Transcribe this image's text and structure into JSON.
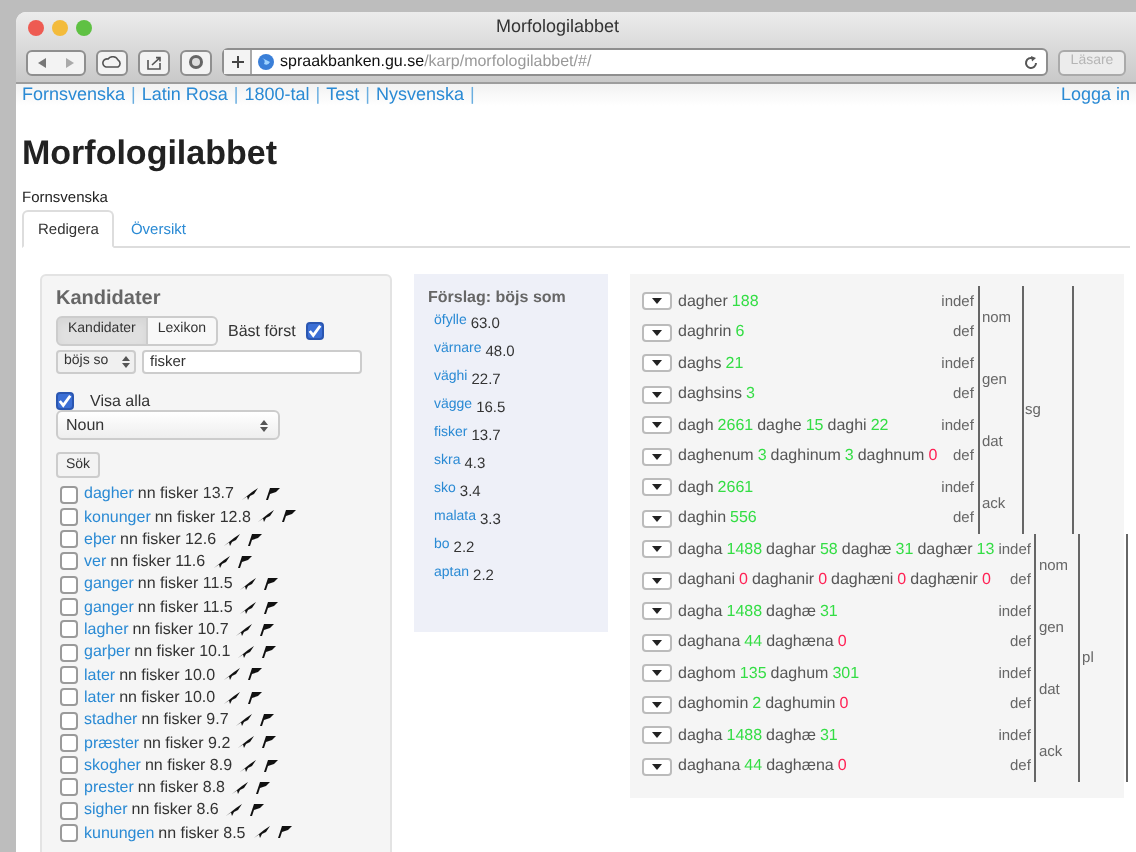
{
  "window": {
    "title": "Morfologilabbet"
  },
  "toolbar": {
    "url_host": "spraakbanken.gu.se",
    "url_path": "/karp/morfologilabbet/#/",
    "reader_button": "Läsare",
    "reader_disabled": true
  },
  "nav": [
    {
      "kind": "link",
      "text": "Fornsvenska"
    },
    {
      "kind": "separator",
      "text": "|"
    },
    {
      "kind": "link",
      "text": "Latin Rosa"
    },
    {
      "kind": "separator",
      "text": "|"
    },
    {
      "kind": "link",
      "text": "1800-tal"
    },
    {
      "kind": "separator",
      "text": "|"
    },
    {
      "kind": "link",
      "text": "Test"
    },
    {
      "kind": "separator",
      "text": "|"
    },
    {
      "kind": "link",
      "text": "Nysvenska"
    },
    {
      "kind": "separator",
      "text": "|"
    }
  ],
  "login": "Logga in",
  "heading": "Morfologilabbet",
  "subheading": "Fornsvenska",
  "tabs": [
    {
      "label": "Redigera",
      "selected": true
    },
    {
      "label": "Översikt",
      "selected": false
    }
  ],
  "candidates_panel": {
    "title": "Kandidater",
    "toggle": [
      {
        "label": "Kandidater",
        "selected": true
      },
      {
        "label": "Lexikon",
        "selected": false
      }
    ],
    "best_first": {
      "label": "Bäst först",
      "checked": true
    },
    "mode_select": "böjs so",
    "query": "fisker",
    "show_all": {
      "label": "Visa alla",
      "checked": true
    },
    "pos_select": "Noun",
    "search_button": "Sök",
    "items": [
      {
        "word": "dagher",
        "rest": "nn fisker 13.7",
        "checked": false
      },
      {
        "word": "konunger",
        "rest": "nn fisker 12.8",
        "checked": false
      },
      {
        "word": "eþer",
        "rest": "nn fisker 12.6",
        "checked": false
      },
      {
        "word": "ver",
        "rest": "nn fisker 11.6",
        "checked": false
      },
      {
        "word": "ganger",
        "rest": "nn fisker 11.5",
        "checked": false
      },
      {
        "word": "ganger",
        "rest": "nn fisker 11.5",
        "checked": false
      },
      {
        "word": "lagher",
        "rest": "nn fisker 10.7",
        "checked": false
      },
      {
        "word": "garþer",
        "rest": "nn fisker 10.1",
        "checked": false
      },
      {
        "word": "later",
        "rest": "nn fisker 10.0",
        "checked": false
      },
      {
        "word": "later",
        "rest": "nn fisker 10.0",
        "checked": false
      },
      {
        "word": "stadher",
        "rest": "nn fisker 9.7",
        "checked": false
      },
      {
        "word": "præster",
        "rest": "nn fisker 9.2",
        "checked": false
      },
      {
        "word": "skogher",
        "rest": "nn fisker 8.9",
        "checked": false
      },
      {
        "word": "prester",
        "rest": "nn fisker 8.8",
        "checked": false
      },
      {
        "word": "sigher",
        "rest": "nn fisker 8.6",
        "checked": false
      },
      {
        "word": "kunungen",
        "rest": "nn fisker 8.5",
        "checked": false
      }
    ]
  },
  "suggestions": {
    "title": "Förslag: böjs som",
    "items": [
      {
        "word": "öfylle",
        "score": "63.0"
      },
      {
        "word": "värnare",
        "score": "48.0"
      },
      {
        "word": "väghi",
        "score": "22.7"
      },
      {
        "word": "vägge",
        "score": "16.5"
      },
      {
        "word": "fisker",
        "score": "13.7"
      },
      {
        "word": "skra",
        "score": "4.3"
      },
      {
        "word": "sko",
        "score": "3.4"
      },
      {
        "word": "malata",
        "score": "3.3"
      },
      {
        "word": "bo",
        "score": "2.2"
      },
      {
        "word": "aptan",
        "score": "2.2"
      }
    ]
  },
  "paradigm": [
    {
      "number": "sg",
      "cases": [
        {
          "case": "nom",
          "rows": [
            {
              "definiteness": "indef",
              "forms": [
                {
                  "word": "dagher",
                  "count": "188",
                  "attested": true
                }
              ]
            },
            {
              "definiteness": "def",
              "forms": [
                {
                  "word": "daghrin",
                  "count": "6",
                  "attested": true
                }
              ]
            }
          ]
        },
        {
          "case": "gen",
          "rows": [
            {
              "definiteness": "indef",
              "forms": [
                {
                  "word": "daghs",
                  "count": "21",
                  "attested": true
                }
              ]
            },
            {
              "definiteness": "def",
              "forms": [
                {
                  "word": "daghsins",
                  "count": "3",
                  "attested": true
                }
              ]
            }
          ]
        },
        {
          "case": "dat",
          "rows": [
            {
              "definiteness": "indef",
              "forms": [
                {
                  "word": "dagh",
                  "count": "2661",
                  "attested": true
                },
                {
                  "word": "daghe",
                  "count": "15",
                  "attested": true
                },
                {
                  "word": "daghi",
                  "count": "22",
                  "attested": true
                }
              ]
            },
            {
              "definiteness": "def",
              "forms": [
                {
                  "word": "daghenum",
                  "count": "3",
                  "attested": true
                },
                {
                  "word": "daghinum",
                  "count": "3",
                  "attested": true
                },
                {
                  "word": "daghnum",
                  "count": "0",
                  "attested": false
                }
              ]
            }
          ]
        },
        {
          "case": "ack",
          "rows": [
            {
              "definiteness": "indef",
              "forms": [
                {
                  "word": "dagh",
                  "count": "2661",
                  "attested": true
                }
              ]
            },
            {
              "definiteness": "def",
              "forms": [
                {
                  "word": "daghin",
                  "count": "556",
                  "attested": true
                }
              ]
            }
          ]
        }
      ]
    },
    {
      "number": "pl",
      "cases": [
        {
          "case": "nom",
          "rows": [
            {
              "definiteness": "indef",
              "forms": [
                {
                  "word": "dagha",
                  "count": "1488",
                  "attested": true
                },
                {
                  "word": "daghar",
                  "count": "58",
                  "attested": true
                },
                {
                  "word": "daghæ",
                  "count": "31",
                  "attested": true
                },
                {
                  "word": "daghær",
                  "count": "13",
                  "attested": true
                }
              ]
            },
            {
              "definiteness": "def",
              "forms": [
                {
                  "word": "daghani",
                  "count": "0",
                  "attested": false
                },
                {
                  "word": "daghanir",
                  "count": "0",
                  "attested": false
                },
                {
                  "word": "daghæni",
                  "count": "0",
                  "attested": false
                },
                {
                  "word": "daghænir",
                  "count": "0",
                  "attested": false
                }
              ]
            }
          ]
        },
        {
          "case": "gen",
          "rows": [
            {
              "definiteness": "indef",
              "forms": [
                {
                  "word": "dagha",
                  "count": "1488",
                  "attested": true
                },
                {
                  "word": "daghæ",
                  "count": "31",
                  "attested": true
                }
              ]
            },
            {
              "definiteness": "def",
              "forms": [
                {
                  "word": "daghana",
                  "count": "44",
                  "attested": true
                },
                {
                  "word": "daghæna",
                  "count": "0",
                  "attested": false
                }
              ]
            }
          ]
        },
        {
          "case": "dat",
          "rows": [
            {
              "definiteness": "indef",
              "forms": [
                {
                  "word": "daghom",
                  "count": "135",
                  "attested": true
                },
                {
                  "word": "daghum",
                  "count": "301",
                  "attested": true
                }
              ]
            },
            {
              "definiteness": "def",
              "forms": [
                {
                  "word": "daghomin",
                  "count": "2",
                  "attested": true
                },
                {
                  "word": "daghumin",
                  "count": "0",
                  "attested": false
                }
              ]
            }
          ]
        },
        {
          "case": "ack",
          "rows": [
            {
              "definiteness": "indef",
              "forms": [
                {
                  "word": "dagha",
                  "count": "1488",
                  "attested": true
                },
                {
                  "word": "daghæ",
                  "count": "31",
                  "attested": true
                }
              ]
            },
            {
              "definiteness": "def",
              "forms": [
                {
                  "word": "daghana",
                  "count": "44",
                  "attested": true
                },
                {
                  "word": "daghæna",
                  "count": "0",
                  "attested": false
                }
              ]
            }
          ]
        }
      ]
    }
  ]
}
